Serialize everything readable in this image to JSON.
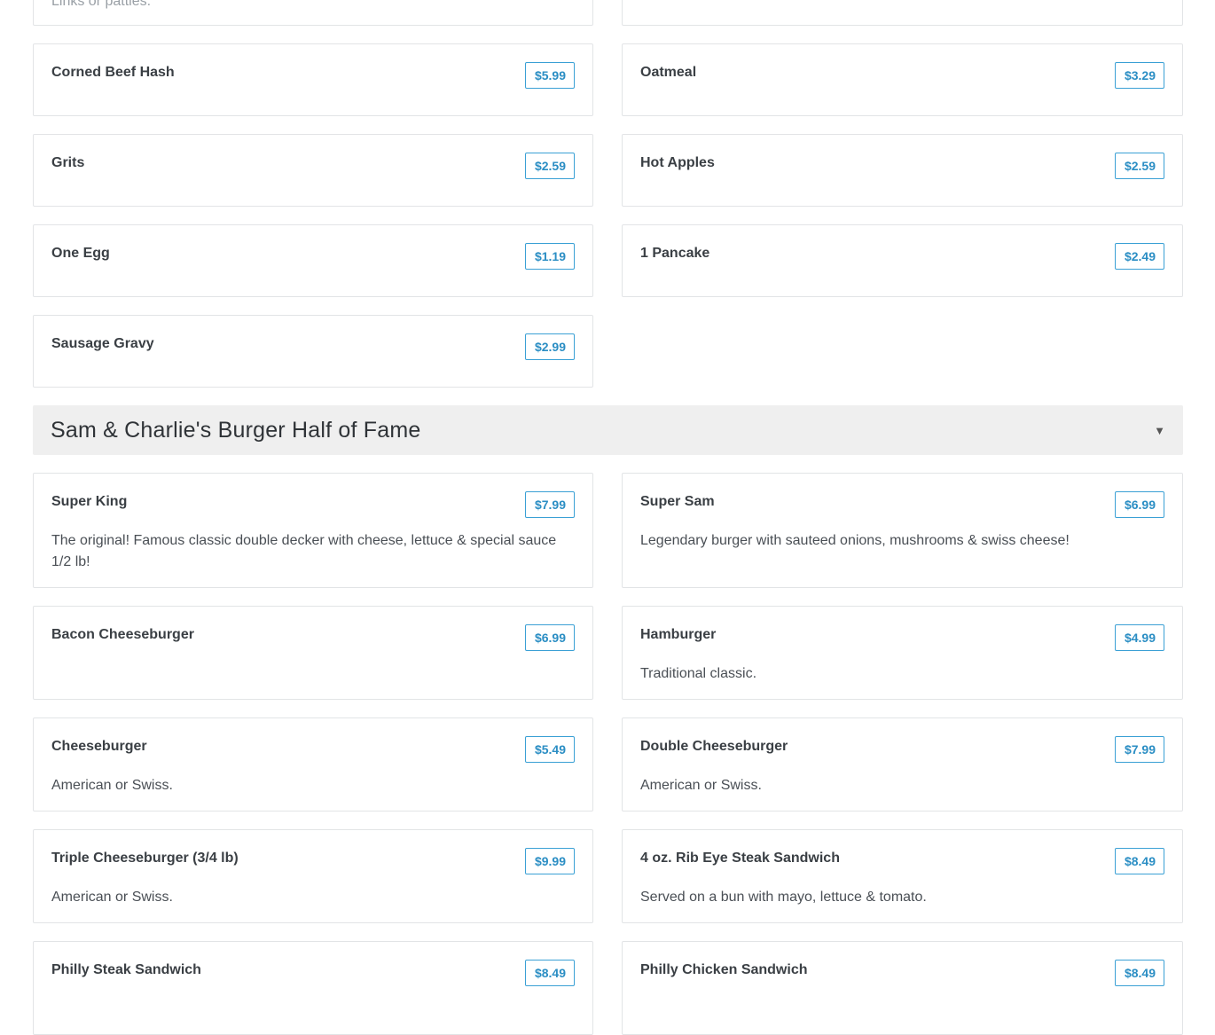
{
  "top_partial": {
    "left_desc": "Links or patties."
  },
  "breakfast_items": [
    {
      "name": "Corned Beef Hash",
      "price": "$5.99"
    },
    {
      "name": "Oatmeal",
      "price": "$3.29"
    },
    {
      "name": "Grits",
      "price": "$2.59"
    },
    {
      "name": "Hot Apples",
      "price": "$2.59"
    },
    {
      "name": "One Egg",
      "price": "$1.19"
    },
    {
      "name": "1 Pancake",
      "price": "$2.49"
    },
    {
      "name": "Sausage Gravy",
      "price": "$2.99"
    }
  ],
  "section": {
    "title": "Sam & Charlie's Burger Half of Fame",
    "toggle_icon": "caret-down-icon"
  },
  "burger_items": [
    {
      "name": "Super King",
      "price": "$7.99",
      "desc": "The original! Famous classic double decker with cheese, lettuce & special sauce 1/2 lb!"
    },
    {
      "name": "Super Sam",
      "price": "$6.99",
      "desc": "Legendary burger with sauteed onions, mushrooms & swiss cheese!"
    },
    {
      "name": "Bacon Cheeseburger",
      "price": "$6.99",
      "desc": ""
    },
    {
      "name": "Hamburger",
      "price": "$4.99",
      "desc": "Traditional classic."
    },
    {
      "name": "Cheeseburger",
      "price": "$5.49",
      "desc": "American or Swiss."
    },
    {
      "name": "Double Cheeseburger",
      "price": "$7.99",
      "desc": "American or Swiss."
    },
    {
      "name": "Triple Cheeseburger (3/4 lb)",
      "price": "$9.99",
      "desc": "American or Swiss."
    },
    {
      "name": "4 oz. Rib Eye Steak Sandwich",
      "price": "$8.49",
      "desc": "Served on a bun with mayo, lettuce & tomato."
    },
    {
      "name": "Philly Steak Sandwich",
      "price": "$8.49",
      "desc": ""
    },
    {
      "name": "Philly Chicken Sandwich",
      "price": "$8.49",
      "desc": ""
    }
  ],
  "colors": {
    "price_accent": "#2b8ec4",
    "section_bg": "#efefef",
    "card_border": "#e2e4e6"
  }
}
